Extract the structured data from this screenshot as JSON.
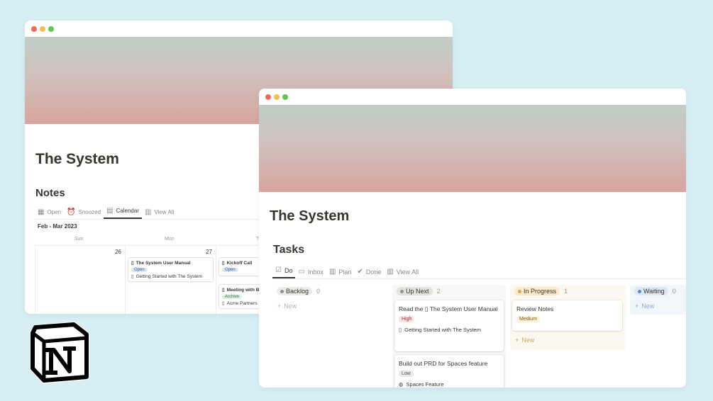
{
  "back_window": {
    "title": "The System",
    "section": "Notes",
    "tabs": [
      {
        "label": "Open",
        "icon": "grid-icon"
      },
      {
        "label": "Snoozed",
        "icon": "alarm-icon"
      },
      {
        "label": "Calendar",
        "icon": "calendar-icon",
        "active": true
      },
      {
        "label": "View All",
        "icon": "table-icon"
      }
    ],
    "date_range": "Feb - Mar 2023",
    "day_headers": [
      "Sun",
      "Mon",
      "T"
    ],
    "days": [
      "26",
      "27"
    ],
    "cards": {
      "c1_title": "The System User Manual",
      "c1_badge": "Open",
      "c1_page": "Getting Started with The System",
      "c2_title": "Kickoff Call",
      "c2_badge": "Open",
      "c3_title": "Meeting with B",
      "c3_badge": "Archive",
      "c3_page": "Acme Partners"
    }
  },
  "front_window": {
    "title": "The System",
    "section": "Tasks",
    "tabs": [
      {
        "label": "Do",
        "icon": "check-square-icon",
        "active": true
      },
      {
        "label": "Inbox",
        "icon": "inbox-icon"
      },
      {
        "label": "Plan",
        "icon": "table-icon"
      },
      {
        "label": "Done",
        "icon": "check-circle-icon"
      },
      {
        "label": "View All",
        "icon": "table-icon"
      }
    ],
    "columns": [
      {
        "name": "Backlog",
        "count": "0",
        "color": "#91918e"
      },
      {
        "name": "Up Next",
        "count": "2",
        "color": "#91918e"
      },
      {
        "name": "In Progress",
        "count": "1",
        "color": "#d9a74a"
      },
      {
        "name": "Waiting",
        "count": "0",
        "color": "#5e87c9"
      }
    ],
    "new_label": "New",
    "cards": {
      "up1_title": "Read the",
      "up1_title_rest": "The System User Manual",
      "up1_tag": "High",
      "up1_rel": "Getting Started with The System",
      "up2_title": "Build out PRD for Spaces feature",
      "up2_tag": "Low",
      "up2_rel": "Spaces Feature",
      "ip1_title": "Review Notes",
      "ip1_tag": "Medium"
    }
  },
  "colors": {
    "background": "#d7eef5",
    "tag_high_bg": "#fbe4e4",
    "tag_medium_bg": "#fbf3db",
    "tag_low_bg": "#e9e9e7"
  }
}
